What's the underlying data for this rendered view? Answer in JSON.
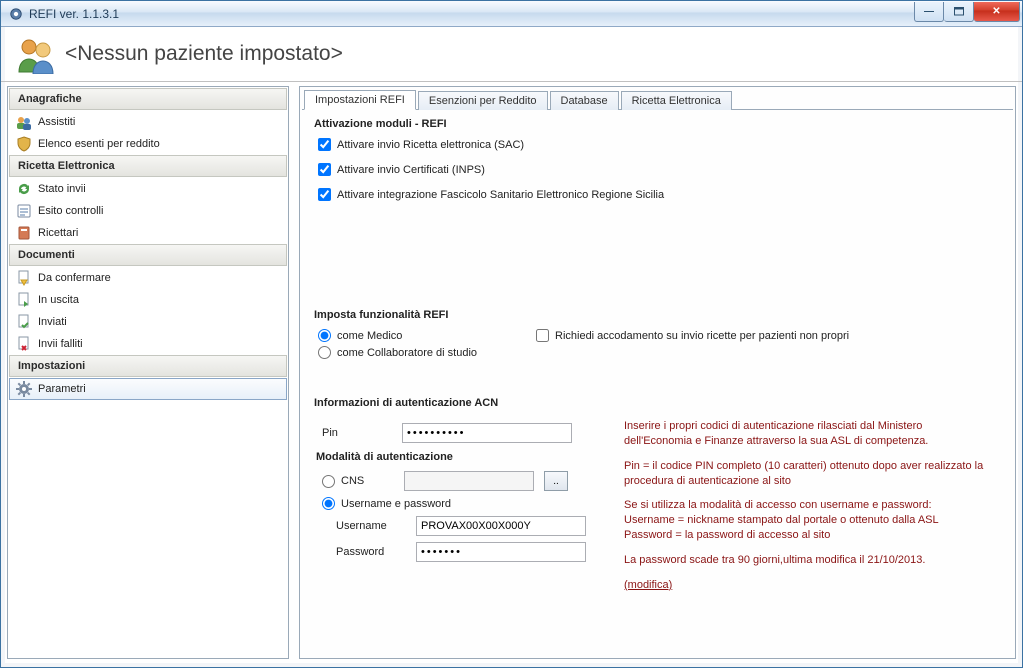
{
  "window": {
    "title": "REFI  ver. 1.1.3.1"
  },
  "header": {
    "patient": "<Nessun paziente impostato>"
  },
  "sidebar": {
    "groups": [
      {
        "title": "Anagrafiche",
        "items": [
          {
            "label": "Assistiti",
            "icon": "people-icon"
          },
          {
            "label": "Elenco esenti per reddito",
            "icon": "shield-icon"
          }
        ]
      },
      {
        "title": "Ricetta Elettronica",
        "items": [
          {
            "label": "Stato invii",
            "icon": "refresh-icon"
          },
          {
            "label": "Esito controlli",
            "icon": "checklist-icon"
          },
          {
            "label": "Ricettari",
            "icon": "book-icon"
          }
        ]
      },
      {
        "title": "Documenti",
        "items": [
          {
            "label": "Da confermare",
            "icon": "doc-warn-icon"
          },
          {
            "label": "In uscita",
            "icon": "doc-out-icon"
          },
          {
            "label": "Inviati",
            "icon": "doc-sent-icon"
          },
          {
            "label": "Invii falliti",
            "icon": "doc-fail-icon"
          }
        ]
      },
      {
        "title": "Impostazioni",
        "items": [
          {
            "label": "Parametri",
            "icon": "gear-icon",
            "selected": true
          }
        ]
      }
    ]
  },
  "tabs": [
    {
      "label": "Impostazioni REFI",
      "active": true
    },
    {
      "label": "Esenzioni per Reddito"
    },
    {
      "label": "Database"
    },
    {
      "label": "Ricetta Elettronica"
    }
  ],
  "moduli": {
    "legend": "Attivazione moduli - REFI",
    "items": [
      {
        "label": "Attivare invio Ricetta elettronica (SAC)",
        "checked": true
      },
      {
        "label": "Attivare invio Certificati (INPS)",
        "checked": true
      },
      {
        "label": "Attivare integrazione Fascicolo Sanitario Elettronico Regione Sicilia",
        "checked": true
      }
    ]
  },
  "funzionalita": {
    "legend": "Imposta funzionalità REFI",
    "radios": [
      {
        "label": "come Medico",
        "checked": true
      },
      {
        "label": "come Collaboratore di studio",
        "checked": false
      }
    ],
    "accodamento": {
      "label": "Richiedi accodamento su invio ricette per pazienti non propri",
      "checked": false
    }
  },
  "auth": {
    "legend": "Informazioni di autenticazione  ACN",
    "pin_label": "Pin",
    "pin_value": "••••••••••",
    "modalita_legend": "Modalità di autenticazione",
    "cns_label": "CNS",
    "cns_value": "",
    "browse_label": "..",
    "userpass_label": "Username e password",
    "username_label": "Username",
    "username_value": "PROVAX00X00X000Y",
    "password_label": "Password",
    "password_value": "•••••••",
    "auth_mode_selected": "userpass"
  },
  "hints": {
    "p1": "Inserire i propri codici di autenticazione rilasciati dal Ministero dell'Economia e Finanze attraverso la sua ASL di competenza.",
    "p2": "Pin = il codice PIN completo (10 caratteri) ottenuto dopo aver realizzato la procedura di autenticazione al sito",
    "p3": "Se si utilizza la modalità di accesso con username e password: Username = nickname stampato dal portale o ottenuto dalla ASL Password = la password di accesso al sito",
    "p4": "La password scade tra 90 giorni,ultima modifica il 21/10/2013.",
    "modifica": "(modifica)"
  }
}
